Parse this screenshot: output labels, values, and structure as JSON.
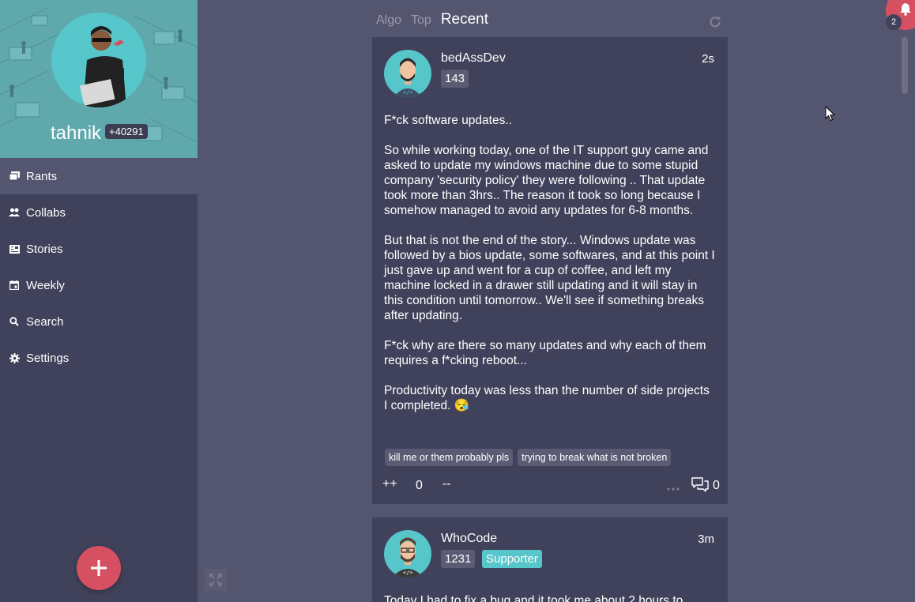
{
  "profile": {
    "name": "tahnik",
    "score": "+40291"
  },
  "sidebar": {
    "items": [
      {
        "label": "Rants",
        "icon": "rants-icon"
      },
      {
        "label": "Collabs",
        "icon": "collabs-icon"
      },
      {
        "label": "Stories",
        "icon": "stories-icon"
      },
      {
        "label": "Weekly",
        "icon": "calendar-icon"
      },
      {
        "label": "Search",
        "icon": "search-icon"
      },
      {
        "label": "Settings",
        "icon": "gear-icon"
      }
    ],
    "add_label": "+"
  },
  "feed": {
    "tabs": [
      {
        "label": "Algo",
        "active": false
      },
      {
        "label": "Top",
        "active": false
      },
      {
        "label": "Recent",
        "active": true
      }
    ]
  },
  "rants": [
    {
      "username": "bedAssDev",
      "score": "143",
      "time": "2s",
      "paragraphs": [
        "F*ck software updates..",
        "So while working today, one of the IT support guy came and asked to update my windows machine due to some stupid company 'security policy' they were following .. That update took more than 3hrs.. The reason it took so long because I somehow managed to avoid any updates for 6-8 months.",
        "But that is not the end of the story... Windows update was followed by a bios update, some softwares, and at this point I just gave up and went for a cup of coffee, and left my machine locked in a drawer still updating and it will stay in this condition until tomorrow.. We'll see if something breaks after updating.",
        "F*ck why are there so many updates and why each of them requires a f*cking reboot...",
        "Productivity today was less than the number of side projects I completed. 😪"
      ],
      "tags": [
        "kill me or them probably pls",
        "trying to break what is not broken"
      ],
      "upvote_label": "++",
      "votes": "0",
      "downvote_label": "--",
      "comments": "0"
    },
    {
      "username": "WhoCode",
      "score": "1231",
      "badge": "Supporter",
      "time": "3m",
      "body": "Today I had to fix a bug and it took me about 2 hours to"
    }
  ],
  "notifications": {
    "count": "2"
  },
  "colors": {
    "background": "#54556e",
    "sidebar": "#40415a",
    "card": "#40415a",
    "accent_red": "#d55161",
    "accent_teal": "#56c6cb"
  }
}
